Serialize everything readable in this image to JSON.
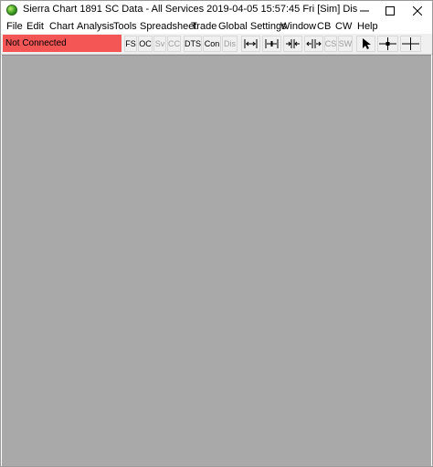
{
  "window": {
    "title": "Sierra Chart 1891 SC Data - All Services 2019-04-05  15:57:45 Fri [Sim]  Dis",
    "minimize_glyph": "—",
    "maximize_glyph": "☐",
    "close_glyph": "✕"
  },
  "menu": {
    "items": [
      "File",
      "Edit",
      "Chart",
      "Analysis",
      "Tools",
      "Spreadsheet",
      "Trade",
      "Global Settings",
      "Window",
      "CB",
      "CW",
      "Help"
    ]
  },
  "toolbar": {
    "status_text": "Not Connected",
    "status_color": "#f45555",
    "buttons": [
      {
        "label": "FS",
        "enabled": true
      },
      {
        "label": "OC",
        "enabled": true
      },
      {
        "label": "Sv",
        "enabled": false
      },
      {
        "label": "CC",
        "enabled": false
      },
      {
        "label": "DTS",
        "enabled": true
      },
      {
        "label": "Con",
        "enabled": true
      },
      {
        "label": "Dis",
        "enabled": false
      },
      {
        "label": "CS",
        "enabled": false
      },
      {
        "label": "SW",
        "enabled": false
      }
    ],
    "icons": [
      "bar-spacing-decrease-icon",
      "bar-spacing-increase-icon",
      "zoom-in-bars-icon",
      "zoom-out-bars-icon",
      "pointer-icon",
      "crosshair-icon",
      "crosshair-large-icon"
    ]
  },
  "chart_area_color": "#a9a9a9"
}
